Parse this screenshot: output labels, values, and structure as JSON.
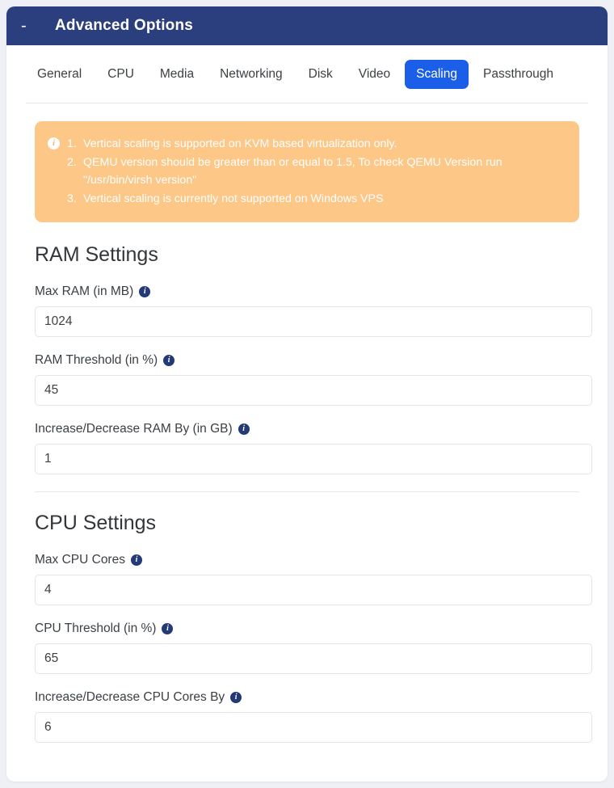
{
  "panel": {
    "title": "Advanced Options",
    "collapse_toggle": "-"
  },
  "tabs": [
    {
      "label": "General",
      "active": false
    },
    {
      "label": "CPU",
      "active": false
    },
    {
      "label": "Media",
      "active": false
    },
    {
      "label": "Networking",
      "active": false
    },
    {
      "label": "Disk",
      "active": false
    },
    {
      "label": "Video",
      "active": false
    },
    {
      "label": "Scaling",
      "active": true
    },
    {
      "label": "Passthrough",
      "active": false
    }
  ],
  "alert": {
    "icon": "info-icon",
    "items": [
      "Vertical scaling is supported on KVM based virtualization only.",
      "QEMU version should be greater than or equal to 1.5, To check QEMU Version run \"/usr/bin/virsh version\"",
      "Vertical scaling is currently not supported on Windows VPS"
    ]
  },
  "ram_section": {
    "title": "RAM Settings",
    "fields": [
      {
        "label": "Max RAM (in MB)",
        "value": "1024",
        "placeholder": ""
      },
      {
        "label": "RAM Threshold (in %)",
        "value": "45",
        "placeholder": ""
      },
      {
        "label": "Increase/Decrease RAM By (in GB)",
        "value": "1",
        "placeholder": ""
      }
    ]
  },
  "cpu_section": {
    "title": "CPU Settings",
    "fields": [
      {
        "label": "Max CPU Cores",
        "value": "4",
        "placeholder": ""
      },
      {
        "label": "CPU Threshold (in %)",
        "value": "65",
        "placeholder": ""
      },
      {
        "label": "Increase/Decrease CPU Cores By",
        "value": "6",
        "placeholder": ""
      }
    ]
  },
  "colors": {
    "header_bg": "#2b3f7f",
    "active_tab_bg": "#1b5ee8",
    "alert_bg": "#fcc787",
    "info_icon_bg": "#233a77",
    "page_bg": "#eef0f6"
  }
}
